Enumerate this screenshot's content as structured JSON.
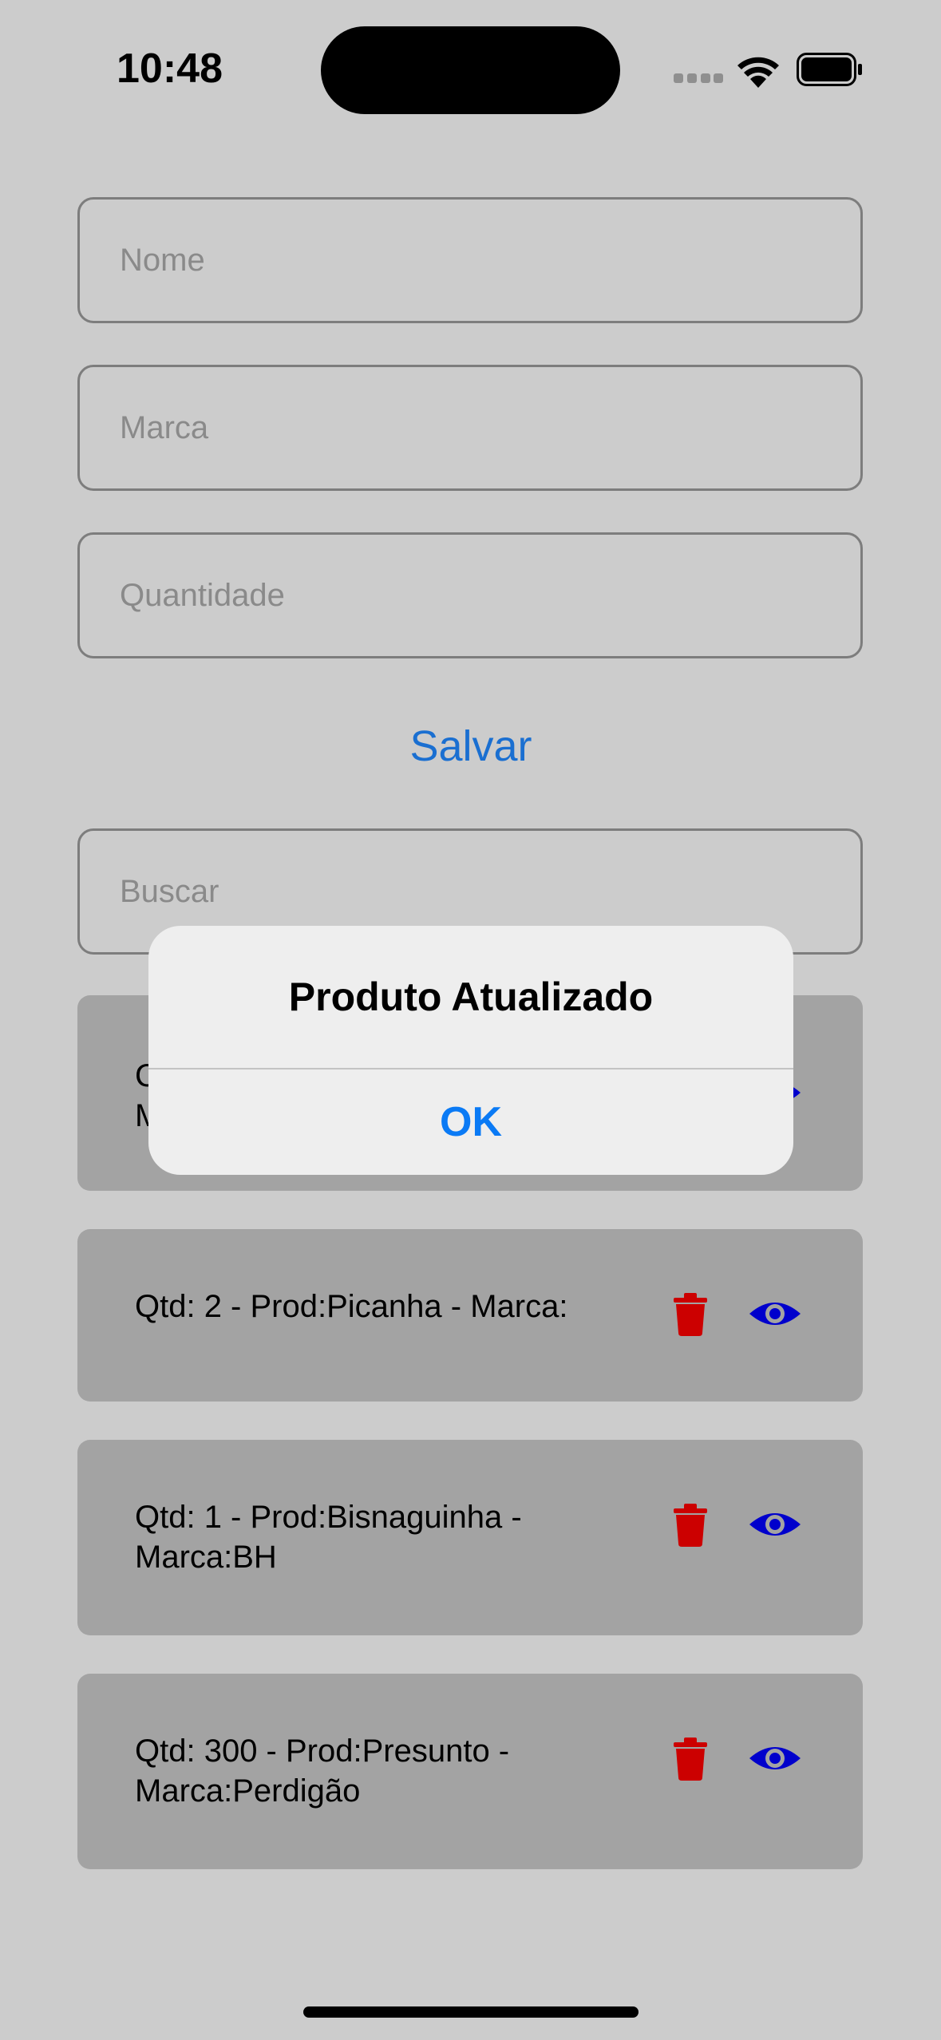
{
  "status_bar": {
    "time": "10:48"
  },
  "form": {
    "name_placeholder": "Nome",
    "brand_placeholder": "Marca",
    "quantity_placeholder": "Quantidade",
    "save_label": "Salvar",
    "search_placeholder": "Buscar"
  },
  "products": [
    {
      "text_line1": "Qtd: 2 - Prod:Picanha - Marca:",
      "text_line2": ""
    },
    {
      "text_line1": "Qtd: 1 - Prod:Bisnaguinha -",
      "text_line2": "Marca:BH"
    },
    {
      "text_line1": "Qtd: 300 - Prod:Presunto -",
      "text_line2": "Marca:Perdigão"
    }
  ],
  "hidden_item": {
    "fragment_line1": "C",
    "fragment_line2": "M"
  },
  "alert": {
    "title": "Produto Atualizado",
    "ok_label": "OK"
  },
  "colors": {
    "background": "#cccccc",
    "card": "#a3a3a3",
    "trash": "#cc0000",
    "eye": "#0000cc",
    "link_blue": "#1a6fd1",
    "alert_blue": "#0a7af5"
  },
  "icons": {
    "delete": "trash-icon",
    "view": "eye-icon"
  }
}
